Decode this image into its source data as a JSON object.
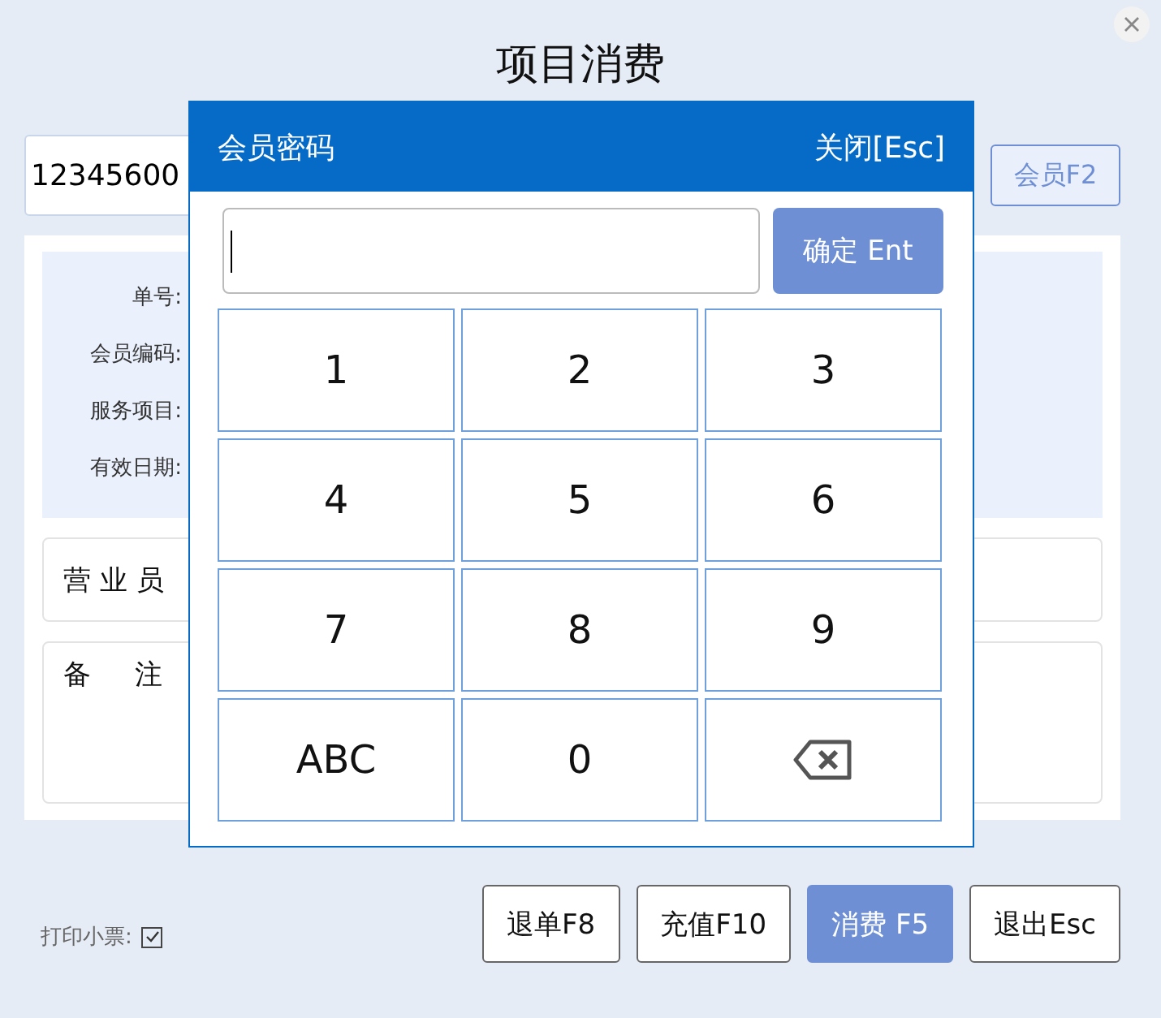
{
  "title": "项目消费",
  "member_field": {
    "value": "12345600"
  },
  "member_button": "会员F2",
  "info_labels": [
    "单号:",
    "会员编码:",
    "服务项目:",
    "有效日期:"
  ],
  "salesperson_label": "营 业 员",
  "remark_label": "备     注",
  "print_receipt": {
    "label": "打印小票:",
    "checked": true
  },
  "buttons": [
    {
      "label": "退单F8",
      "primary": false
    },
    {
      "label": "充值F10",
      "primary": false
    },
    {
      "label": "消费 F5",
      "primary": true
    },
    {
      "label": "退出Esc",
      "primary": false
    }
  ],
  "dialog": {
    "title": "会员密码",
    "close": "关闭[Esc]",
    "confirm": "确定 Ent",
    "keys": [
      {
        "kind": "key",
        "label": "1"
      },
      {
        "kind": "key",
        "label": "2"
      },
      {
        "kind": "key",
        "label": "3"
      },
      {
        "kind": "key",
        "label": "4"
      },
      {
        "kind": "key",
        "label": "5"
      },
      {
        "kind": "key",
        "label": "6"
      },
      {
        "kind": "key",
        "label": "7"
      },
      {
        "kind": "key",
        "label": "8"
      },
      {
        "kind": "key",
        "label": "9"
      },
      {
        "kind": "key",
        "label": "ABC"
      },
      {
        "kind": "key",
        "label": "0"
      },
      {
        "kind": "backspace"
      }
    ]
  }
}
